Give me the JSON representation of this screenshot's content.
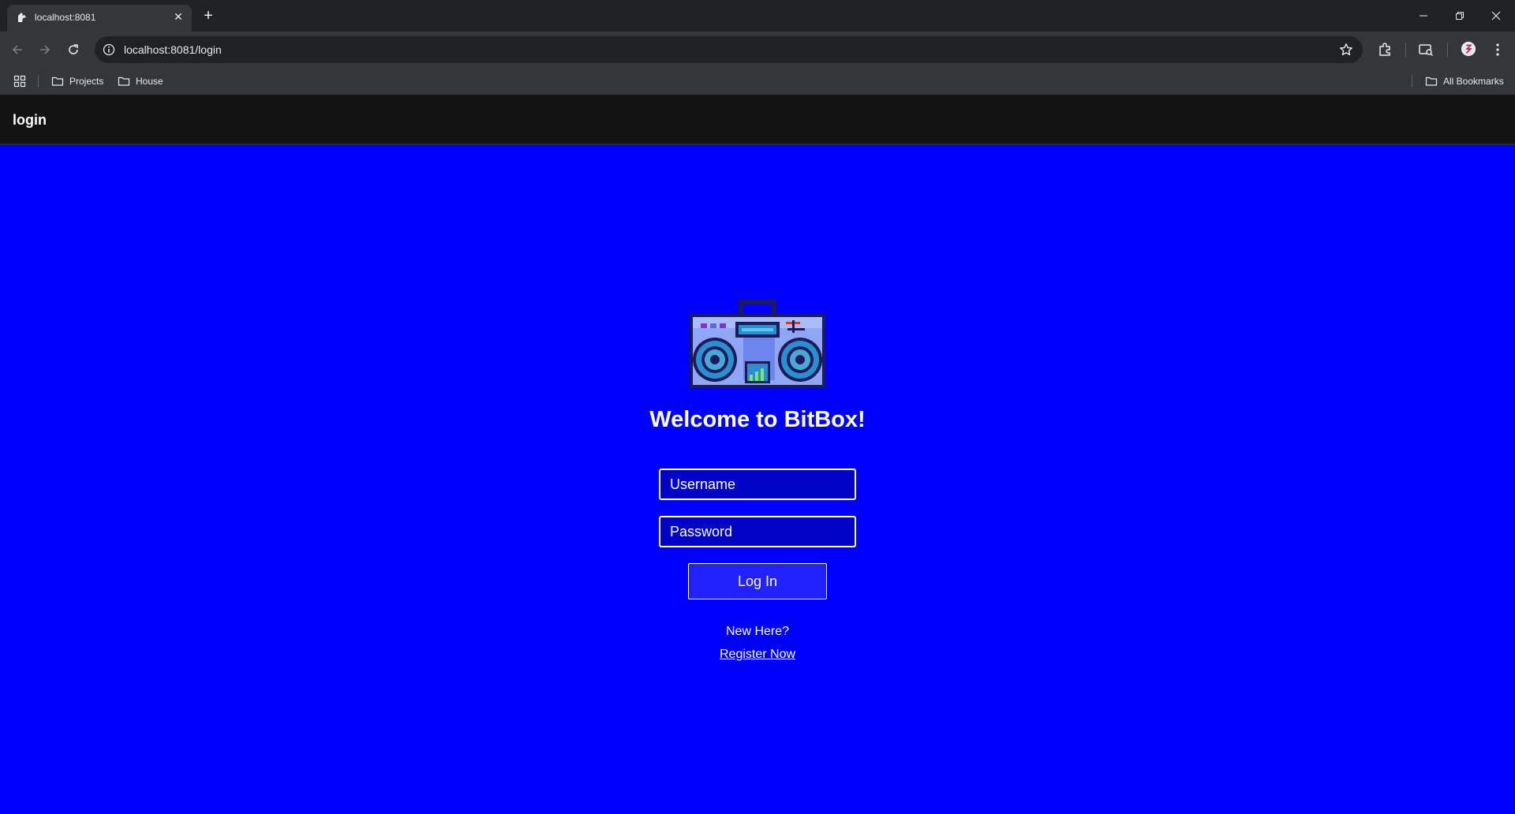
{
  "browser": {
    "tab_title": "localhost:8081",
    "url": "localhost:8081/login",
    "bookmarks": [
      "Projects",
      "House"
    ],
    "all_bookmarks_label": "All Bookmarks"
  },
  "app": {
    "header_title": "login",
    "background_color": "#0000ff"
  },
  "login": {
    "logo_icon": "boombox-icon",
    "welcome": "Welcome to BitBox!",
    "username_placeholder": "Username",
    "password_placeholder": "Password",
    "submit_label": "Log In",
    "new_here": "New Here?",
    "register_link": "Register Now"
  }
}
